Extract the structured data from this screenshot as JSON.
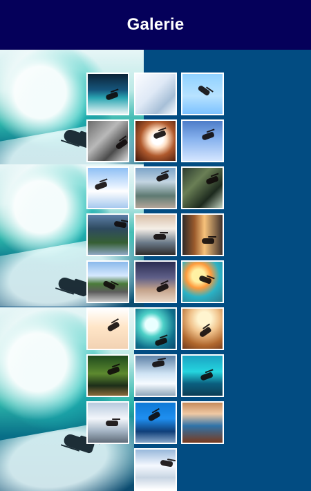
{
  "header": {
    "title": "Galerie",
    "bg": "#05005a"
  },
  "page": {
    "bg": "#024c82"
  },
  "gallery": {
    "items": [
      {
        "id": "img-01"
      },
      {
        "id": "img-02"
      },
      {
        "id": "img-03"
      },
      {
        "id": "img-04"
      },
      {
        "id": "img-05"
      },
      {
        "id": "img-06"
      },
      {
        "id": "img-07"
      },
      {
        "id": "img-08"
      },
      {
        "id": "img-09"
      },
      {
        "id": "img-10"
      },
      {
        "id": "img-11"
      },
      {
        "id": "img-12"
      },
      {
        "id": "img-13"
      },
      {
        "id": "img-14"
      },
      {
        "id": "img-15"
      },
      {
        "id": "img-16"
      },
      {
        "id": "img-17"
      },
      {
        "id": "img-18"
      },
      {
        "id": "img-19"
      },
      {
        "id": "img-20"
      },
      {
        "id": "img-21"
      },
      {
        "id": "img-22"
      },
      {
        "id": "img-23"
      },
      {
        "id": "img-24"
      },
      {
        "id": "img-25"
      }
    ]
  }
}
